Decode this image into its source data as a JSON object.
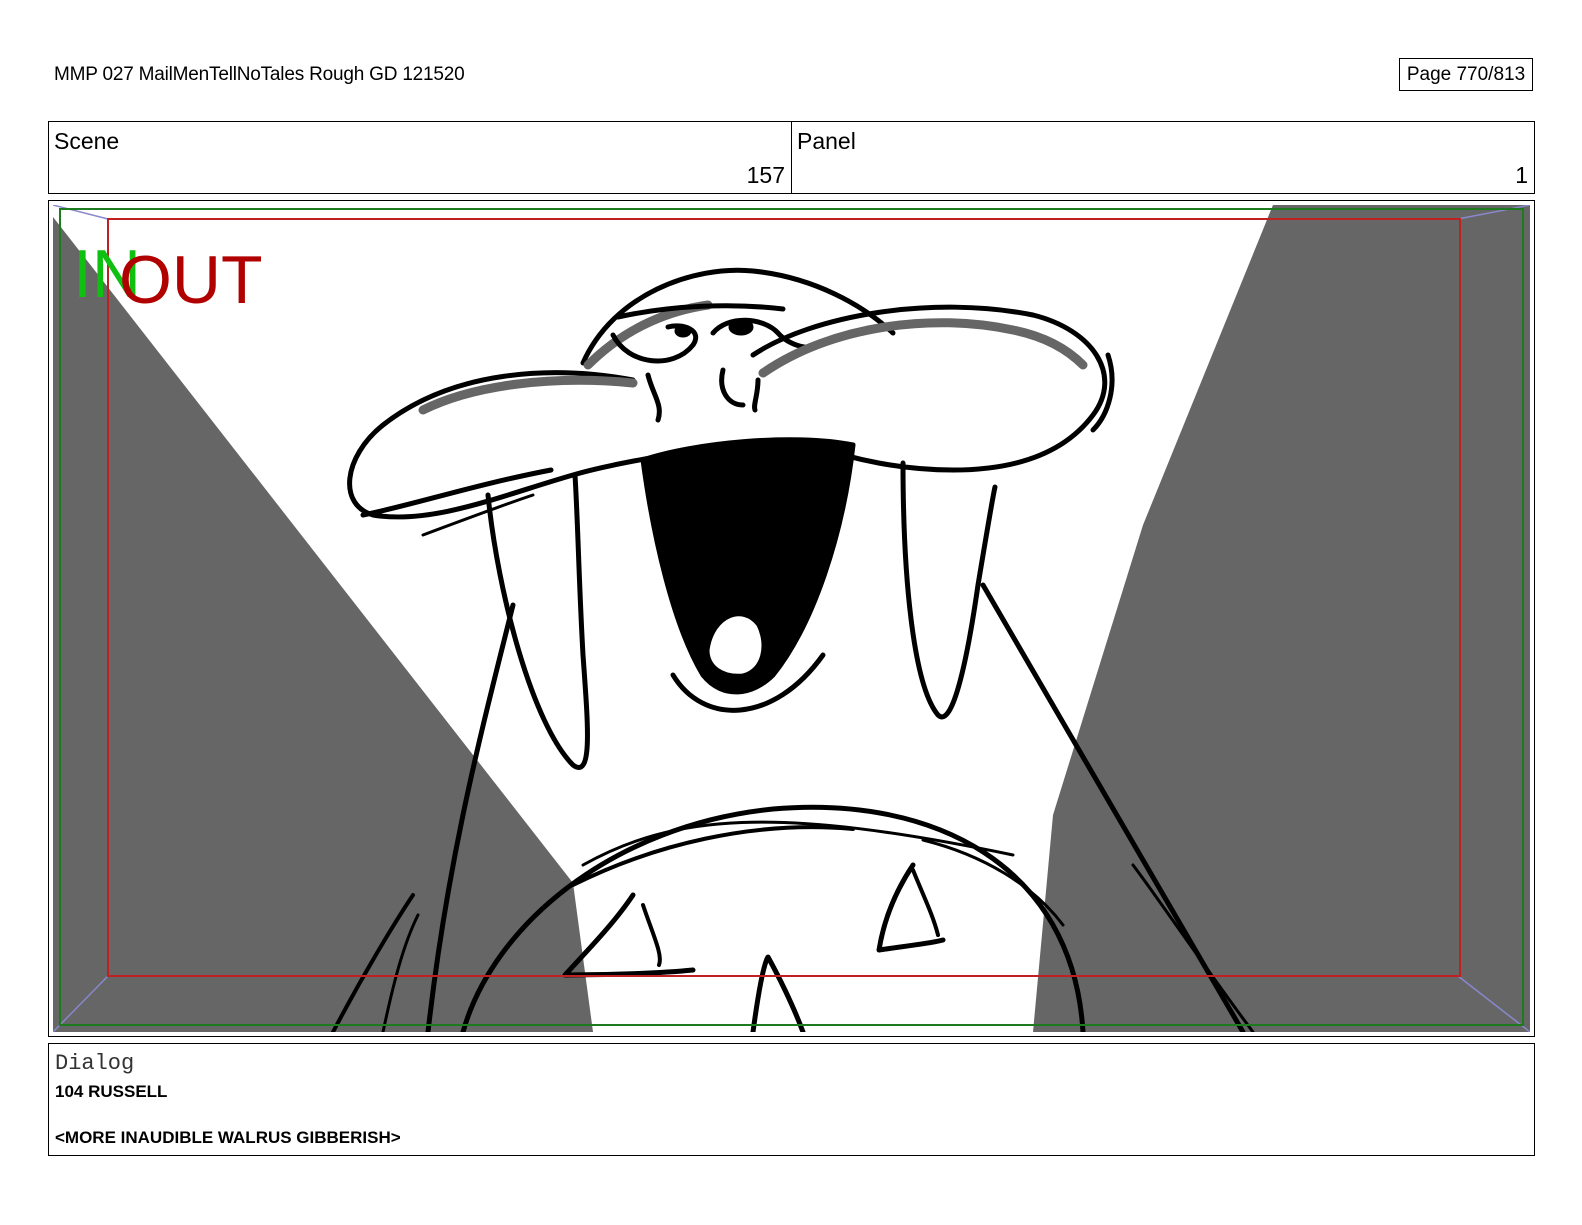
{
  "header": {
    "document_title": "MMP 027 MailMenTellNoTales Rough GD 121520",
    "page_label": "Page 770/813"
  },
  "scene": {
    "label": "Scene",
    "value": "157"
  },
  "panel": {
    "label": "Panel",
    "value": "1"
  },
  "frame_markers": {
    "in_label": "IN",
    "out_label": "OUT",
    "in_color": "#10c010",
    "out_color": "#b00000",
    "safe_frame_color": "#1e7a1e",
    "title_safe_color": "#c02020"
  },
  "artwork": {
    "background_color": "#ffffff",
    "shadow_color": "#666666",
    "line_color": "#000000"
  },
  "dialog": {
    "label": "Dialog",
    "speaker": "104 RUSSELL",
    "line": "<MORE INAUDIBLE WALRUS GIBBERISH>"
  }
}
